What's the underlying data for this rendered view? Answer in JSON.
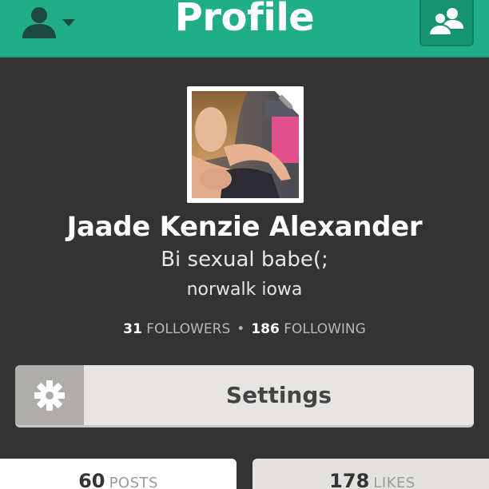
{
  "header": {
    "title": "Profile",
    "brand_color": "#1fae85",
    "left_icon": "user-dropdown-icon",
    "right_icon": "friends-icon"
  },
  "profile": {
    "name": "Jaade Kenzie Alexander",
    "bio": "Bi sexual babe(;",
    "location": "norwalk iowa",
    "avatar_edit_icon": "pencil-icon"
  },
  "stats": {
    "followers_count": "31",
    "followers_label": "FOLLOWERS",
    "following_count": "186",
    "following_label": "FOLLOWING",
    "separator": "•"
  },
  "settings": {
    "label": "Settings",
    "icon": "gear-icon"
  },
  "tabs": {
    "posts_count": "60",
    "posts_label": "POSTS",
    "likes_count": "178",
    "likes_label": "LIKES"
  }
}
